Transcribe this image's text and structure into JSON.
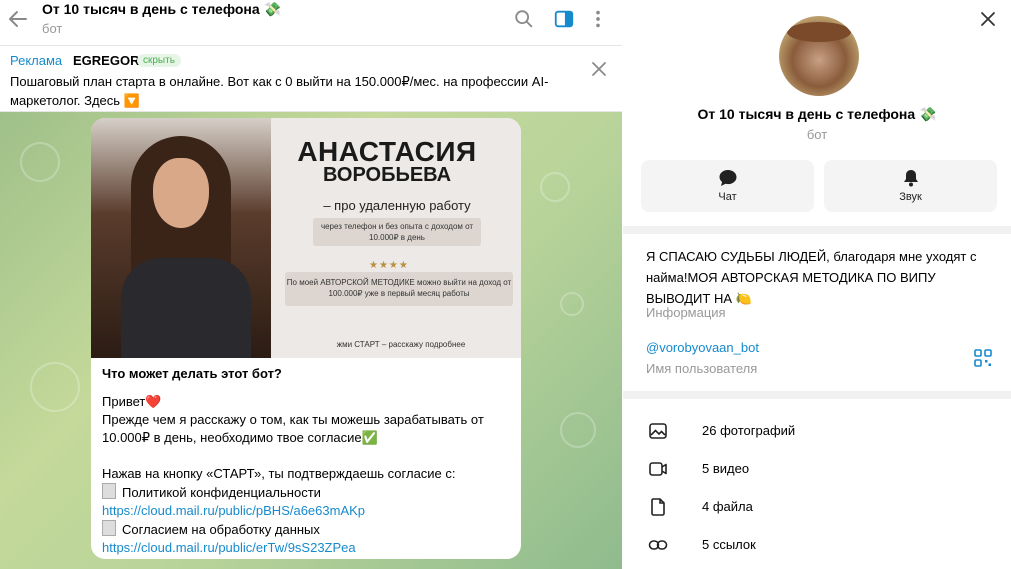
{
  "chat": {
    "title": "От 10 тысяч в день с телефона 💸",
    "subtitle": "бот"
  },
  "ad": {
    "label": "Реклама",
    "name": "EGREGOR",
    "hide_label": "скрыть",
    "text": "Пошаговый план старта в онлайне. Вот как с 0 выйти на 150.000₽/мес. на профессии AI-маркетолог. Здесь 🔽"
  },
  "promo": {
    "name_line1": "АНАСТАСИЯ",
    "name_line2": "ВОРОБЬЕВА",
    "tagline": "– про удаленную работу",
    "box1": "через телефон и без опыта с доходом от 10.000₽ в день",
    "stars": "★★★★",
    "box2": "По моей АВТОРСКОЙ МЕТОДИКЕ можно выйти на доход от 100.000₽ уже в первый месяц работы",
    "cta": "жми СТАРТ – расскажу подробнее"
  },
  "message": {
    "question": "Что может делать этот бот?",
    "greeting": "Привет❤️",
    "para1": "Прежде чем я расскажу о том, как ты можешь зарабатывать от 10.000₽ в день, необходимо твое согласие✅",
    "para2": "Нажав на кнопку «СТАРТ», ты подтверждаешь согласие с:",
    "doc1_label": "Политикой конфиденциальности",
    "doc1_link": "https://cloud.mail.ru/public/pBHS/a6e63mAKp",
    "doc2_label": "Согласием на обработку данных",
    "doc2_link": "https://cloud.mail.ru/public/erTw/9sS23ZPea"
  },
  "info": {
    "title": "От 10 тысяч в день с телефона 💸",
    "subtitle": "бот",
    "actions": [
      {
        "label": "Чат",
        "icon": "chat-icon"
      },
      {
        "label": "Звук",
        "icon": "bell-icon"
      }
    ],
    "bio": "Я СПАСАЮ СУДЬБЫ ЛЮДЕЙ, благодаря мне уходят с найма!МОЯ АВТОРСКАЯ МЕТОДИКА ПО ВИПУ ВЫВОДИТ НА 🍋",
    "bio_label": "Информация",
    "username": "@vorobyovaan_bot",
    "username_label": "Имя пользователя",
    "media": [
      {
        "label": "26 фотографий",
        "icon": "photo-icon"
      },
      {
        "label": "5 видео",
        "icon": "video-icon"
      },
      {
        "label": "4 файла",
        "icon": "file-icon"
      },
      {
        "label": "5 ссылок",
        "icon": "link-icon"
      }
    ]
  },
  "colors": {
    "accent": "#168acd",
    "muted": "#999999",
    "chat_bg": "#b8d39a"
  }
}
